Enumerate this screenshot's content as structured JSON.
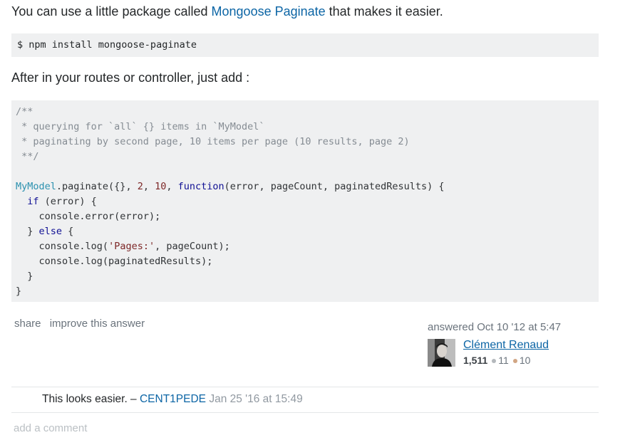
{
  "intro": {
    "before": "You can use a little package called ",
    "link": "Mongoose Paginate",
    "after": " that makes it easier."
  },
  "install_cmd": "$ npm install mongoose-paginate",
  "after_text": "After in your routes or controller, just add :",
  "code": {
    "comment_lines": [
      "/**",
      " * querying for `all` {} items in `MyModel`",
      " * paginating by second page, 10 items per page (10 results, page 2)",
      " **/"
    ],
    "model": "MyModel",
    "call": ".paginate({}, ",
    "arg_page": "2",
    "sep": ", ",
    "arg_limit": "10",
    "sep2": ", ",
    "fn_kw": "function",
    "fn_sig": "(error, pageCount, paginatedResults) {",
    "if_kw": "if",
    "if_cond": " (error) {",
    "error_call": "console.error(error);",
    "else_open": "} ",
    "else_kw": "else",
    "else_rest": " {",
    "log1_pre": "console.log(",
    "log1_str": "'Pages:'",
    "log1_post": ", pageCount);",
    "log2": "console.log(paginatedResults);",
    "close_inner": "}",
    "close_outer": "}"
  },
  "post_menu": {
    "share": "share",
    "improve": "improve this answer"
  },
  "signature": {
    "action": "answered Oct 10 '12 at 5:47",
    "user_name": "Clément Renaud",
    "reputation": "1,511",
    "silver": "11",
    "bronze": "10",
    "silver_color": "#b4b8bc",
    "bronze_color": "#d1a684"
  },
  "comment": {
    "text": "This looks easier. – ",
    "user": "CENT1PEDE",
    "date": " Jan 25 '16 at 15:49"
  },
  "add_comment": "add a comment"
}
